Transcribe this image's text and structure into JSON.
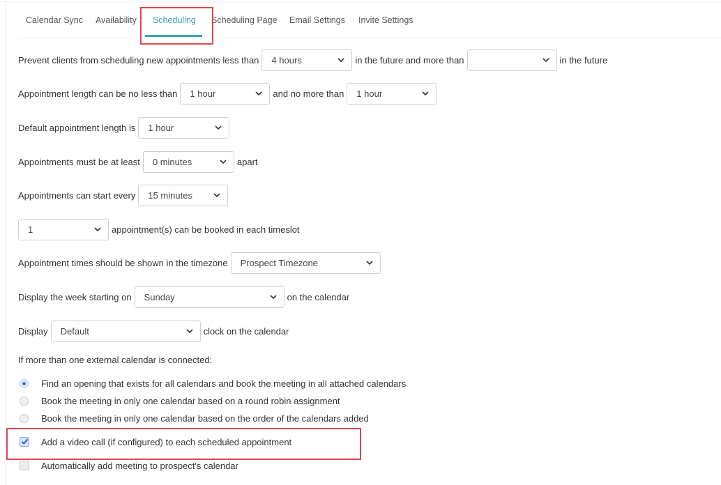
{
  "tabs": [
    {
      "label": "Calendar Sync"
    },
    {
      "label": "Availability"
    },
    {
      "label": "Scheduling"
    },
    {
      "label": "Scheduling Page"
    },
    {
      "label": "Email Settings"
    },
    {
      "label": "Invite Settings"
    }
  ],
  "active_tab": "Scheduling",
  "settings": {
    "prevent": {
      "prefix": "Prevent clients from scheduling new appointments less than",
      "min_value": "4 hours",
      "middle": "in the future and more than",
      "max_value": "",
      "suffix": "in the future"
    },
    "length": {
      "prefix": "Appointment length can be no less than",
      "min_value": "1 hour",
      "middle": "and no more than",
      "max_value": "1 hour"
    },
    "default_length": {
      "prefix": "Default appointment length is",
      "value": "1 hour"
    },
    "apart": {
      "prefix": "Appointments must be at least",
      "value": "0 minutes",
      "suffix": "apart"
    },
    "start_every": {
      "prefix": "Appointments can start every",
      "value": "15 minutes"
    },
    "per_slot": {
      "value": "1",
      "suffix": "appointment(s) can be booked in each timeslot"
    },
    "timezone": {
      "prefix": "Appointment times should be shown in the timezone",
      "value": "Prospect Timezone"
    },
    "week_start": {
      "prefix": "Display the week starting on",
      "value": "Sunday",
      "suffix": "on the calendar"
    },
    "clock": {
      "prefix": "Display",
      "value": "Default",
      "suffix": "clock on the calendar"
    }
  },
  "external_calendar": {
    "label": "If more than one external calendar is connected:",
    "options": [
      {
        "label": "Find an opening that exists for all calendars and book the meeting in all attached calendars",
        "selected": true
      },
      {
        "label": "Book the meeting in only one calendar based on a round robin assignment",
        "selected": false
      },
      {
        "label": "Book the meeting in only one calendar based on the order of the calendars added",
        "selected": false
      }
    ]
  },
  "checkboxes": [
    {
      "label": "Add a video call (if configured) to each scheduled appointment",
      "checked": true
    },
    {
      "label": "Automatically add meeting to prospect's calendar",
      "checked": false
    }
  ],
  "colors": {
    "accent": "#3aa3a8",
    "highlight": "#e4474b",
    "radio_selected": "#3b7bd8"
  }
}
